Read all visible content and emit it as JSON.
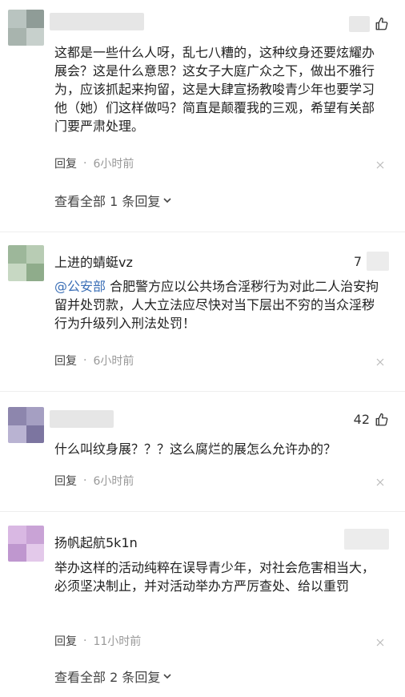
{
  "comments": [
    {
      "username": "",
      "likes": "",
      "text": "这都是一些什么人呀，乱七八糟的，这种纹身还要炫耀办展会？这是什么意思？这女子大庭广众之下，做出不雅行为，应该抓起来拘留，这是大肆宣扬教唆青少年也要学习他（她）们这样做吗？简直是颠覆我的三观，希望有关部门要严肃处理。",
      "reply_label": "回复",
      "separator": "·",
      "time": "6小时前",
      "view_all": "查看全部 1 条回复"
    },
    {
      "username": "上进的蜻蜓vz",
      "likes": "7",
      "mention": "@公安部",
      "text": " 合肥警方应以公共场合淫秽行为对此二人治安拘留并处罚款，人大立法应尽快对当下层出不穷的当众淫秽行为升级列入刑法处罚！",
      "reply_label": "回复",
      "separator": "·",
      "time": "6小时前"
    },
    {
      "username": "",
      "likes": "42",
      "text": "什么叫纹身展？？？这么腐烂的展怎么允许办的？",
      "reply_label": "回复",
      "separator": "·",
      "time": "6小时前"
    },
    {
      "username": "扬帆起航5k1n",
      "likes": "",
      "text": "举办这样的活动纯粹在误导青少年，对社会危害相当大，必须坚决制止，并对活动举办方严厉查处、给以重罚",
      "reply_label": "回复",
      "separator": "·",
      "time": "11小时前",
      "view_all": "查看全部 2 条回复"
    }
  ],
  "icons": {
    "like": "thumbs-up-icon",
    "close": "close-icon",
    "expand": "chevron-down-icon"
  },
  "colors": {
    "mention": "#3b6fb6",
    "meta": "#999999",
    "text": "#222222"
  }
}
